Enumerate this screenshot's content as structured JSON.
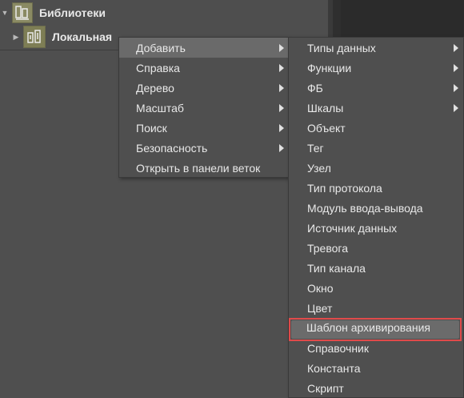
{
  "tree": {
    "libraries_label": "Библиотеки",
    "local_label": "Локальная"
  },
  "context_menu": {
    "items": [
      {
        "label": "Добавить",
        "submenu": true
      },
      {
        "label": "Справка",
        "submenu": true
      },
      {
        "label": "Дерево",
        "submenu": true
      },
      {
        "label": "Масштаб",
        "submenu": true
      },
      {
        "label": "Поиск",
        "submenu": true
      },
      {
        "label": "Безопасность",
        "submenu": true
      },
      {
        "label": "Открыть в панели веток",
        "submenu": false
      }
    ]
  },
  "add_submenu": {
    "items": [
      {
        "label": "Типы данных",
        "submenu": true
      },
      {
        "label": "Функции",
        "submenu": true
      },
      {
        "label": "ФБ",
        "submenu": true
      },
      {
        "label": "Шкалы",
        "submenu": true
      },
      {
        "label": "Объект",
        "submenu": false
      },
      {
        "label": "Тег",
        "submenu": false
      },
      {
        "label": "Узел",
        "submenu": false
      },
      {
        "label": "Тип протокола",
        "submenu": false
      },
      {
        "label": "Модуль ввода-вывода",
        "submenu": false
      },
      {
        "label": "Источник данных",
        "submenu": false
      },
      {
        "label": "Тревога",
        "submenu": false
      },
      {
        "label": "Тип канала",
        "submenu": false
      },
      {
        "label": "Окно",
        "submenu": false
      },
      {
        "label": "Цвет",
        "submenu": false
      },
      {
        "label": "Шаблон архивирования",
        "submenu": false
      },
      {
        "label": "Справочник",
        "submenu": false
      },
      {
        "label": "Константа",
        "submenu": false
      },
      {
        "label": "Скрипт",
        "submenu": false
      }
    ],
    "highlighted_item": "Шаблон архивирования"
  },
  "colors": {
    "background": "#4f4f4f",
    "menu_active": "#6a6a6a",
    "highlight_border": "#e04a4a",
    "icon_olive": "#8a8a63"
  }
}
